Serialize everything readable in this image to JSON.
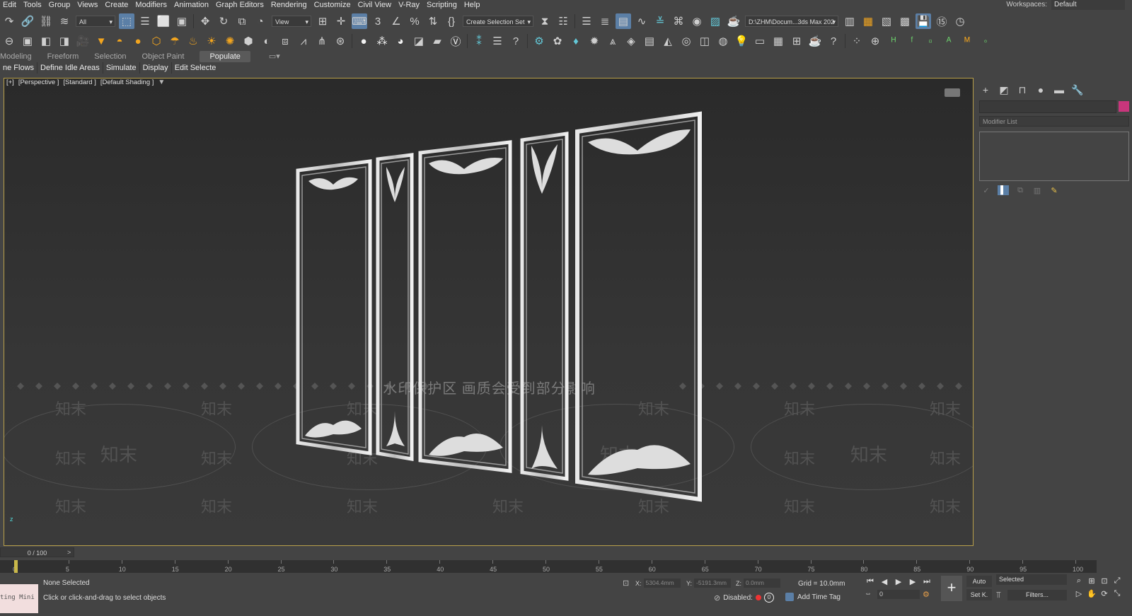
{
  "menubar": {
    "items": [
      "Edit",
      "Tools",
      "Group",
      "Views",
      "Create",
      "Modifiers",
      "Animation",
      "Graph Editors",
      "Rendering",
      "Customize",
      "Civil View",
      "V-Ray",
      "Scripting",
      "Help"
    ],
    "workspace_label": "Workspaces:",
    "workspace_value": "Default"
  },
  "toolbar1": {
    "selection_filter": "All",
    "ref_coord": "View",
    "selection_set": "Create Selection Set",
    "project_path": "D:\\ZHM\\Docum...3ds Max 202"
  },
  "ribbon": {
    "tabs": [
      "Modeling",
      "Freeform",
      "Selection",
      "Object Paint",
      "Populate"
    ],
    "active_tab": "Populate",
    "sub_items": [
      "ne Flows",
      "Define Idle Areas",
      "Simulate",
      "Display",
      "Edit Selected"
    ]
  },
  "viewport": {
    "label_view": "[+]",
    "label_camera": "[Perspective ]",
    "label_standard": "[Standard ]",
    "label_shading": "[Default Shading ]",
    "watermark_text": "水印保护区  画质会受到部分影响",
    "watermark_brand": "知末",
    "axis_label": "z"
  },
  "command_panel": {
    "modifier_list": "Modifier List",
    "swatch_color": "#c8367c"
  },
  "timeline": {
    "frame_counter": "0 / 100",
    "next": ">",
    "ticks": [
      "0",
      "5",
      "10",
      "15",
      "20",
      "25",
      "30",
      "35",
      "40",
      "45",
      "50",
      "55",
      "60",
      "65",
      "70",
      "75",
      "80",
      "85",
      "90",
      "95",
      "100"
    ]
  },
  "status": {
    "mini_listener": "ting Mini",
    "selection": "None Selected",
    "prompt": "Click or click-and-drag to select objects",
    "x_label": "X:",
    "x_value": "5304.4mm",
    "y_label": "Y:",
    "y_value": "-5191.3mm",
    "z_label": "Z:",
    "z_value": "0.0mm",
    "grid": "Grid = 10.0mm",
    "disabled": "Disabled:",
    "disabled_value": "0",
    "add_time_tag": "Add Time Tag",
    "auto": "Auto",
    "set_k": "Set K.",
    "selected": "Selected",
    "filters": "Filters...",
    "frame_value": "0"
  }
}
